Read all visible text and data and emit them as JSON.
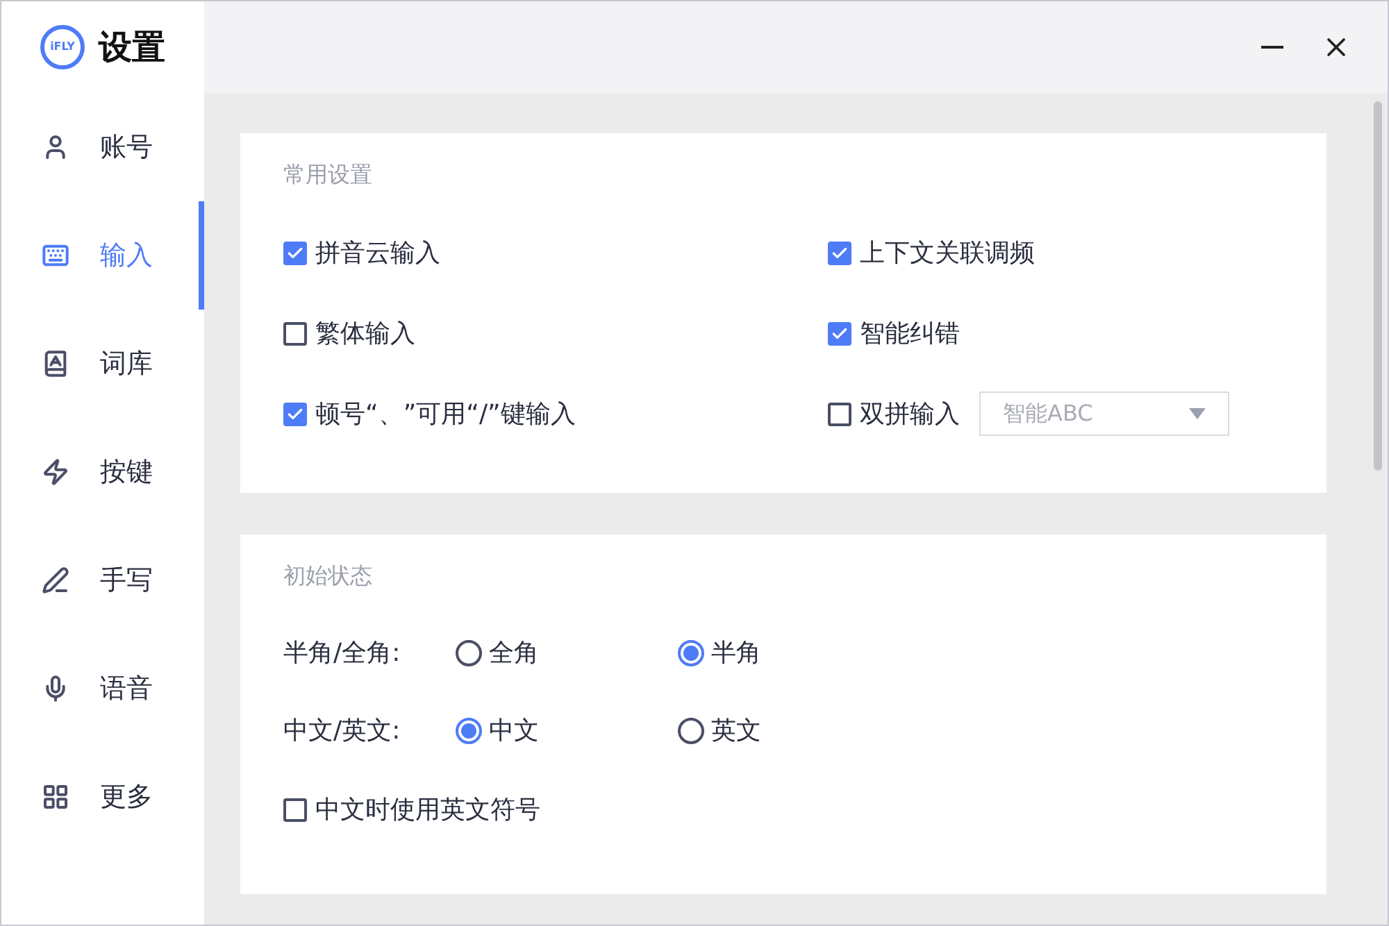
{
  "app": {
    "logo": "iFLY",
    "title": "设置"
  },
  "sidebar": {
    "items": [
      {
        "label": "账号",
        "selected": false
      },
      {
        "label": "输入",
        "selected": true
      },
      {
        "label": "词库",
        "selected": false
      },
      {
        "label": "按键",
        "selected": false
      },
      {
        "label": "手写",
        "selected": false
      },
      {
        "label": "语音",
        "selected": false
      },
      {
        "label": "更多",
        "selected": false
      }
    ]
  },
  "sections": [
    {
      "title": "常用设置",
      "items": [
        {
          "kind": "checkbox",
          "label": "拼音云输入",
          "checked": true
        },
        {
          "kind": "checkbox",
          "label": "上下文关联调频",
          "checked": true
        },
        {
          "kind": "checkbox",
          "label": "繁体输入",
          "checked": false
        },
        {
          "kind": "checkbox",
          "label": "智能纠错",
          "checked": true
        },
        {
          "kind": "checkbox",
          "label": "顿号“、”可用“/”键输入",
          "checked": true
        },
        {
          "kind": "checkbox_select",
          "label": "双拼输入",
          "checked": false,
          "select": {
            "value": "智能ABC"
          }
        }
      ]
    },
    {
      "title": "初始状态",
      "items": [
        {
          "kind": "radio",
          "label": "半角/全角:",
          "options": [
            {
              "label": "全角",
              "selected": false
            },
            {
              "label": "半角",
              "selected": true
            }
          ]
        },
        {
          "kind": "radio",
          "label": "中文/英文:",
          "options": [
            {
              "label": "中文",
              "selected": true
            },
            {
              "label": "英文",
              "selected": false
            }
          ]
        },
        {
          "kind": "checkbox",
          "label": "中文时使用英文符号",
          "checked": false
        }
      ]
    }
  ]
}
